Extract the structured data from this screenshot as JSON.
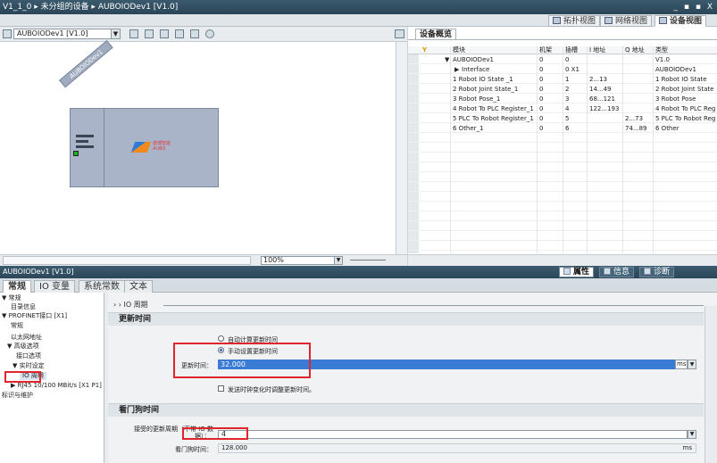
{
  "titlebar": {
    "path": "V1_1_0 ▸ 未分组的设备 ▸ AUBOIODev1 [V1.0]",
    "controls": "_ ▪ ▪ X"
  },
  "view_tabs": {
    "topology": "拓扑视图",
    "network": "网络视图",
    "device": "设备视图"
  },
  "graph_toolbar": {
    "device_select": "AUBOIODev1 [V1.0]"
  },
  "device_graphic": {
    "label": "AUBOIODev1",
    "logo_text": "遨博智能\nAUBO"
  },
  "graph_footer": {
    "zoom": "100%"
  },
  "overview": {
    "tab": "设备概览",
    "columns": [
      "模块",
      "机架",
      "插槽",
      "I 地址",
      "Q 地址",
      "类型"
    ],
    "rows": [
      [
        "AUBOIODev1",
        "0",
        "0",
        "",
        "",
        "V1.0"
      ],
      [
        "Interface",
        "0",
        "0 X1",
        "",
        "",
        "AUBOIODev1"
      ],
      [
        "1 Robot IO State _1",
        "0",
        "1",
        "2...13",
        "",
        "1 Robot IO State"
      ],
      [
        "2 Robot Joint State_1",
        "0",
        "2",
        "14...49",
        "",
        "2 Robot Joint State"
      ],
      [
        "3 Robot Pose_1",
        "0",
        "3",
        "68...121",
        "",
        "3 Robot Pose"
      ],
      [
        "4 Robot To PLC Register_1",
        "0",
        "4",
        "122...193",
        "",
        "4 Robot To PLC Reg..."
      ],
      [
        "5 PLC To Robot Register_1",
        "0",
        "5",
        "",
        "2...73",
        "5 PLC To Robot Reg..."
      ],
      [
        "6 Other_1",
        "0",
        "6",
        "",
        "74...89",
        "6 Other"
      ]
    ]
  },
  "props_bar": {
    "title": "AUBOIODev1 [V1.0]",
    "properties": "属性",
    "info": "信息",
    "diagnostics": "诊断"
  },
  "sub_tabs": {
    "general": "常规",
    "io_vars": "IO 变量",
    "sys_const": "系统常数",
    "text": "文本"
  },
  "nav": {
    "general": "▼ 常规",
    "catalog": "目录信息",
    "profinet": "▼ PROFINET接口 [X1]",
    "general2": "常规",
    "ethernet": "以太网地址",
    "advanced": "▼ 高级选项",
    "interface_opt": "接口选项",
    "realtime": "▼ 实时设定",
    "io_cycle": "IO 周期",
    "rj45": "▶ RJ45 10/100 MBit/s [X1 P1]",
    "identity": "标识与维护"
  },
  "content": {
    "crumb": "› › IO 周期",
    "update_time_header": "更新时间",
    "auto_label": "自动计算更新时间",
    "manual_label": "手动设置更新时间",
    "update_time_label": "更新时间：",
    "update_time_value": "32.000",
    "unit_ms": "ms",
    "adapt_label": "发送时钟变化时调整更新时间。",
    "watchdog_header": "看门狗时间",
    "accepted_cycles_label": "接受的更新周期（不带 IO 数",
    "accepted_cycles_label2": "据）：",
    "accepted_cycles_value": "4",
    "watchdog_label": "看门狗时间：",
    "watchdog_value": "128.000",
    "watchdog_unit": "ms"
  },
  "colors": {
    "highlight": "#e0262d",
    "accent": "#3a7bd5",
    "titlebar": "#2a4557"
  }
}
